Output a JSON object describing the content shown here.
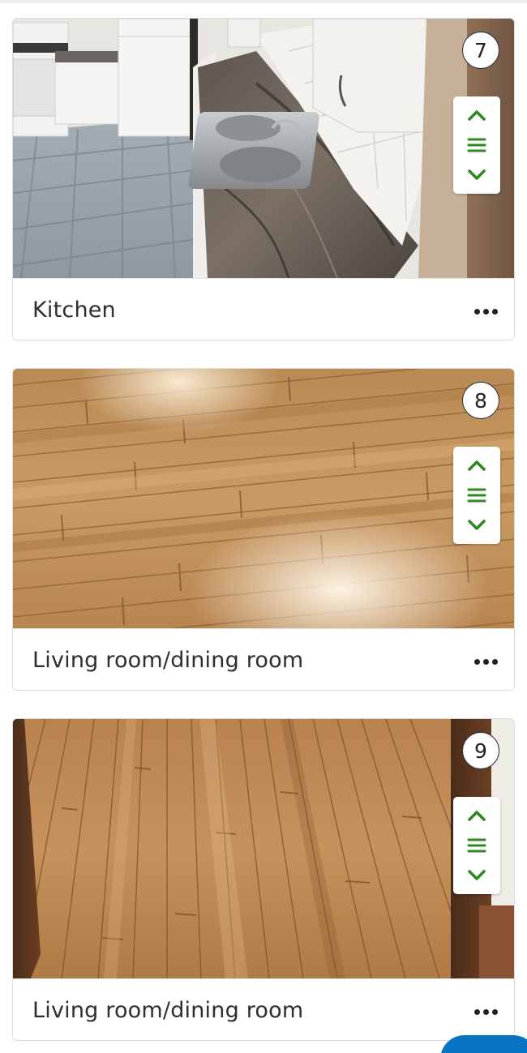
{
  "photos": [
    {
      "order": "7",
      "caption": "Kitchen",
      "room": "kitchen"
    },
    {
      "order": "8",
      "caption": "Living room/dining room",
      "room": "hardwood-floor-glossy"
    },
    {
      "order": "9",
      "caption": "Living room/dining room",
      "room": "hardwood-floor-hallway"
    }
  ],
  "controls": {
    "move_up_icon": "chevron-up-icon",
    "drag_handle_icon": "drag-handle-icon",
    "move_down_icon": "chevron-down-icon",
    "more_icon": "more-options-icon"
  },
  "colors": {
    "control_green": "#2e8a1f",
    "accent_blue": "#0a74c4",
    "text": "#2b2f33"
  }
}
